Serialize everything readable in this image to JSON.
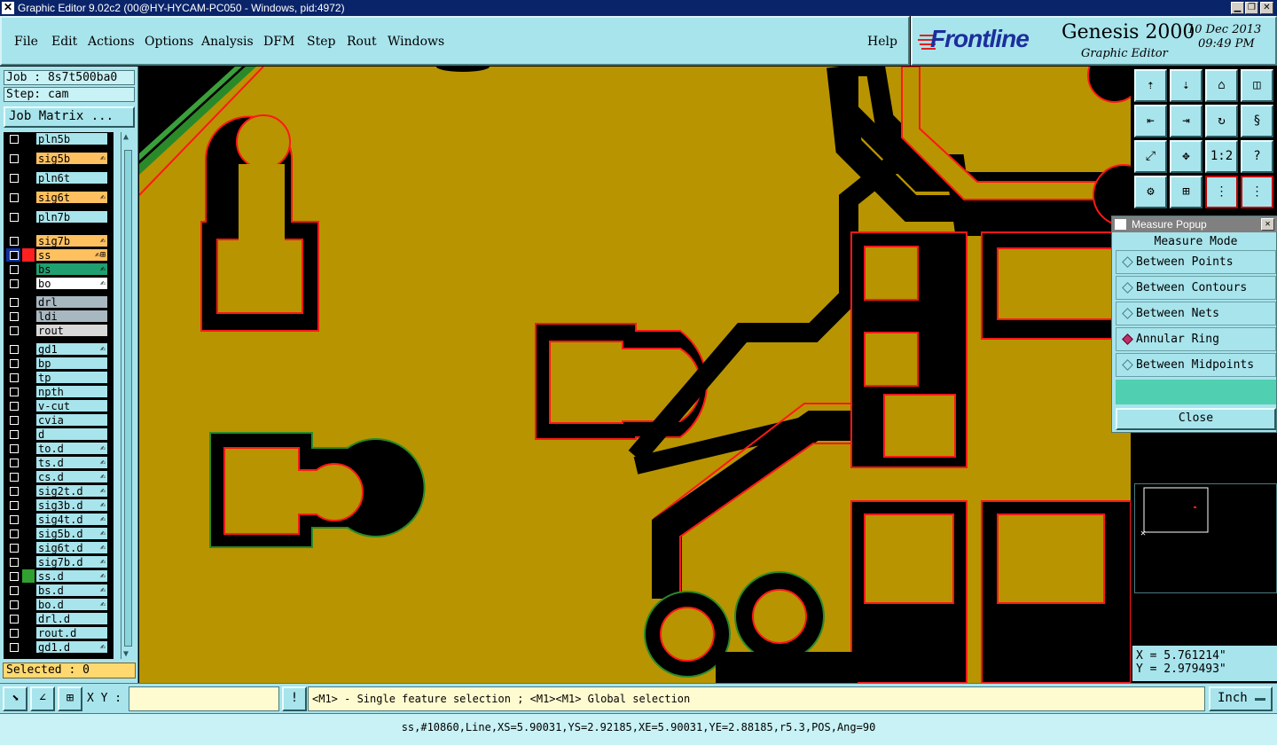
{
  "window": {
    "title": "Graphic Editor 9.02c2 (00@HY-HYCAM-PC050 - Windows, pid:4972)"
  },
  "menu": [
    "File",
    "Edit",
    "Actions",
    "Options",
    "Analysis",
    "DFM",
    "Step",
    "Rout",
    "Windows"
  ],
  "help_label": "Help",
  "logo": {
    "brand": "Frontline",
    "product": "Genesis 2000",
    "subtitle": "Graphic Editor",
    "date": "10 Dec 2013",
    "time": "09:49 PM"
  },
  "job": {
    "job_line": "Job : 8s7t500ba0",
    "step_line": "Step: cam",
    "matrix_button": "Job Matrix ..."
  },
  "layers": [
    {
      "name": "pln5b",
      "bg": "#a8e4ec",
      "marker": ""
    },
    {
      "name": "sig5b",
      "bg": "#ffc060",
      "marker": "✍"
    },
    {
      "name": "pln6t",
      "bg": "#a8e4ec",
      "marker": ""
    },
    {
      "name": "sig6t",
      "bg": "#ffc060",
      "marker": "✍"
    },
    {
      "name": "pln7b",
      "bg": "#a8e4ec",
      "marker": ""
    },
    {
      "name": "sig7b",
      "bg": "#ffc060",
      "marker": "✍"
    },
    {
      "name": "ss",
      "bg": "#ffc060",
      "marker": "✍⊞",
      "color": "#ff2020",
      "selected": true
    },
    {
      "name": "bs",
      "bg": "#20a070",
      "marker": "✍"
    },
    {
      "name": "bo",
      "bg": "#ffffff",
      "marker": "✍"
    },
    {
      "name": "drl",
      "bg": "#a8b8c0",
      "marker": ""
    },
    {
      "name": "ldi",
      "bg": "#a8b8c0",
      "marker": ""
    },
    {
      "name": "rout",
      "bg": "#d8d8d8",
      "marker": ""
    },
    {
      "name": "gd1",
      "bg": "#a8e4ec",
      "marker": "✍"
    },
    {
      "name": "bp",
      "bg": "#a8e4ec",
      "marker": ""
    },
    {
      "name": "tp",
      "bg": "#a8e4ec",
      "marker": ""
    },
    {
      "name": "npth",
      "bg": "#a8e4ec",
      "marker": ""
    },
    {
      "name": "v-cut",
      "bg": "#a8e4ec",
      "marker": ""
    },
    {
      "name": "cvia",
      "bg": "#a8e4ec",
      "marker": ""
    },
    {
      "name": "d",
      "bg": "#a8e4ec",
      "marker": ""
    },
    {
      "name": "to.d",
      "bg": "#a8e4ec",
      "marker": "✍"
    },
    {
      "name": "ts.d",
      "bg": "#a8e4ec",
      "marker": "✍"
    },
    {
      "name": "cs.d",
      "bg": "#a8e4ec",
      "marker": "✍"
    },
    {
      "name": "sig2t.d",
      "bg": "#a8e4ec",
      "marker": "✍"
    },
    {
      "name": "sig3b.d",
      "bg": "#a8e4ec",
      "marker": "✍"
    },
    {
      "name": "sig4t.d",
      "bg": "#a8e4ec",
      "marker": "✍"
    },
    {
      "name": "sig5b.d",
      "bg": "#a8e4ec",
      "marker": "✍"
    },
    {
      "name": "sig6t.d",
      "bg": "#a8e4ec",
      "marker": "✍"
    },
    {
      "name": "sig7b.d",
      "bg": "#a8e4ec",
      "marker": "✍"
    },
    {
      "name": "ss.d",
      "bg": "#a8e4ec",
      "marker": "✍",
      "color": "#30a030"
    },
    {
      "name": "bs.d",
      "bg": "#a8e4ec",
      "marker": "✍"
    },
    {
      "name": "bo.d",
      "bg": "#a8e4ec",
      "marker": "✍"
    },
    {
      "name": "drl.d",
      "bg": "#a8e4ec",
      "marker": ""
    },
    {
      "name": "rout.d",
      "bg": "#a8e4ec",
      "marker": ""
    },
    {
      "name": "gd1.d",
      "bg": "#a8e4ec",
      "marker": "✍"
    }
  ],
  "selected_text": "Selected : 0",
  "toolbar_icons": [
    "home-up-icon",
    "home-down-icon",
    "home-icon",
    "window-icon",
    "pan-left-icon",
    "pan-right-icon",
    "flip-icon",
    "snake-icon",
    "zoom-fit-icon",
    "zoom-center-icon",
    "ratio-icon",
    "help-icon",
    "tools-icon",
    "grid-icon",
    "layer-icon-a",
    "layer-icon-b"
  ],
  "ratio_label": "1:2",
  "help_glyph": "?",
  "measure_popup": {
    "title": "Measure Popup",
    "mode_label": "Measure Mode",
    "options": [
      {
        "label": "Between Points",
        "selected": false
      },
      {
        "label": "Between Contours",
        "selected": false
      },
      {
        "label": "Between Nets",
        "selected": false
      },
      {
        "label": "Annular Ring",
        "selected": true
      },
      {
        "label": "Between Midpoints",
        "selected": false
      }
    ],
    "close_label": "Close"
  },
  "coords": {
    "x": "X = 5.761214\"",
    "y": "Y = 2.979493\""
  },
  "bottom": {
    "xy_label": "X Y :",
    "xy_value": "",
    "message": "<M1> - Single feature selection ; <M1><M1> Global selection",
    "units": "Inch",
    "excl": "!"
  },
  "status_line": "ss,#10860,Line,XS=5.90031,YS=2.92185,XE=5.90031,YE=2.88185,r5.3,POS,Ang=90",
  "colors": {
    "copper": "#b89400",
    "outline": "#ff1818",
    "mask_edge": "#2a8a2a",
    "panel": "#a8e4ec"
  }
}
